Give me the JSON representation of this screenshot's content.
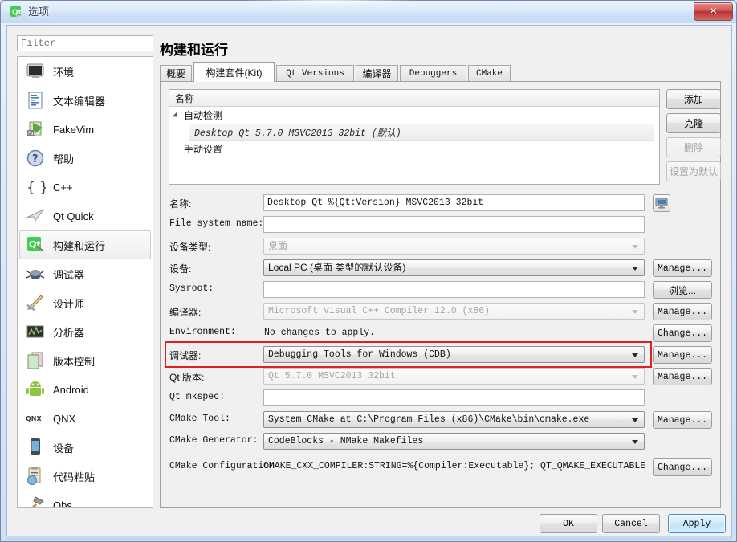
{
  "window": {
    "title": "选项",
    "app_icon": "qt-logo-icon",
    "close_label": "✕"
  },
  "filter": {
    "placeholder": "Filter",
    "value": ""
  },
  "sidebar": {
    "items": [
      {
        "label": "环境",
        "icon": "monitor-icon"
      },
      {
        "label": "文本编辑器",
        "icon": "text-editor-icon"
      },
      {
        "label": "FakeVim",
        "icon": "fakevim-icon"
      },
      {
        "label": "帮助",
        "icon": "help-question-icon"
      },
      {
        "label": "C++",
        "icon": "braces-icon"
      },
      {
        "label": "Qt Quick",
        "icon": "paper-plane-icon"
      },
      {
        "label": "构建和运行",
        "icon": "qt-build-icon"
      },
      {
        "label": "调试器",
        "icon": "bug-icon"
      },
      {
        "label": "设计师",
        "icon": "designer-pen-icon"
      },
      {
        "label": "分析器",
        "icon": "analyzer-icon"
      },
      {
        "label": "版本控制",
        "icon": "version-control-icon"
      },
      {
        "label": "Android",
        "icon": "android-icon"
      },
      {
        "label": "QNX",
        "icon": "qnx-icon"
      },
      {
        "label": "设备",
        "icon": "device-phone-icon"
      },
      {
        "label": "代码粘贴",
        "icon": "code-paste-icon"
      },
      {
        "label": "Qbs",
        "icon": "hammer-icon"
      }
    ],
    "selected_index": 6
  },
  "pane": {
    "title": "构建和运行",
    "tabs": [
      {
        "label": "概要",
        "active": false,
        "cjk": true
      },
      {
        "label": "构建套件(Kit)",
        "active": true,
        "cjk": true
      },
      {
        "label": "Qt Versions",
        "active": false,
        "cjk": false
      },
      {
        "label": "编译器",
        "active": false,
        "cjk": true
      },
      {
        "label": "Debuggers",
        "active": false,
        "cjk": false
      },
      {
        "label": "CMake",
        "active": false,
        "cjk": false
      }
    ]
  },
  "kit_list": {
    "header": "名称",
    "group_label": "自动检测",
    "kit_item": "Desktop Qt 5.7.0 MSVC2013 32bit  (默认)",
    "manual_label": "手动设置"
  },
  "list_buttons": [
    {
      "label": "添加",
      "enabled": true
    },
    {
      "label": "克隆",
      "enabled": true
    },
    {
      "label": "删除",
      "enabled": false
    },
    {
      "label": "设置为默认",
      "enabled": false
    }
  ],
  "form": {
    "rows": [
      {
        "label": "名称:",
        "cjk_label": true,
        "type": "text",
        "value": "Desktop Qt %{Qt:Version} MSVC2013 32bit",
        "enabled": true,
        "side": "monitor-button"
      },
      {
        "label": "File system name:",
        "cjk_label": false,
        "type": "text",
        "value": "",
        "enabled": true,
        "side": ""
      },
      {
        "label": "设备类型:",
        "cjk_label": true,
        "type": "combo",
        "value": "桌面",
        "cjk_value": true,
        "enabled": false,
        "side": ""
      },
      {
        "label": "设备:",
        "cjk_label": true,
        "type": "combo",
        "value": "Local PC (桌面 类型的默认设备)",
        "cjk_value": true,
        "enabled": true,
        "side": "Manage..."
      },
      {
        "label": "Sysroot:",
        "cjk_label": false,
        "type": "text",
        "value": "",
        "enabled": true,
        "side": "浏览...",
        "side_cjk": true
      },
      {
        "label": "编译器:",
        "cjk_label": true,
        "type": "combo",
        "value": "Microsoft Visual C++ Compiler 12.0 (x86)",
        "enabled": false,
        "side": "Manage..."
      },
      {
        "label": "Environment:",
        "cjk_label": false,
        "type": "static",
        "value": "No changes to apply.",
        "enabled": true,
        "side": "Change..."
      },
      {
        "label": "调试器:",
        "cjk_label": true,
        "type": "combo",
        "value": "Debugging Tools for Windows (CDB)",
        "enabled": true,
        "side": "Manage...",
        "highlighted": true
      },
      {
        "label": "Qt 版本:",
        "cjk_label": true,
        "type": "combo",
        "value": "Qt 5.7.0 MSVC2013 32bit",
        "enabled": false,
        "side": "Manage..."
      },
      {
        "label": "Qt mkspec:",
        "cjk_label": false,
        "type": "text",
        "value": "",
        "enabled": true,
        "side": ""
      },
      {
        "label": "CMake Tool:",
        "cjk_label": false,
        "type": "combo",
        "value": "System CMake at C:\\Program Files (x86)\\CMake\\bin\\cmake.exe",
        "enabled": true,
        "side": "Manage..."
      },
      {
        "label": "CMake Generator:",
        "cjk_label": false,
        "type": "combo",
        "value": "CodeBlocks - NMake Makefiles",
        "enabled": true,
        "side": ""
      }
    ],
    "cmake_config": {
      "label": "CMake Configuration",
      "value": "CMAKE_CXX_COMPILER:STRING=%{Compiler:Executable}; QT_QMAKE_EXECUTABLE:STRING…",
      "button": "Change..."
    }
  },
  "dialog_buttons": [
    {
      "label": "OK",
      "default": false
    },
    {
      "label": "Cancel",
      "default": false
    },
    {
      "label": "Apply",
      "default": true
    }
  ],
  "colors": {
    "highlight_red": "#e02020",
    "title_blue": "#cfe2f6",
    "accent_blue": "#3c8fd0"
  }
}
